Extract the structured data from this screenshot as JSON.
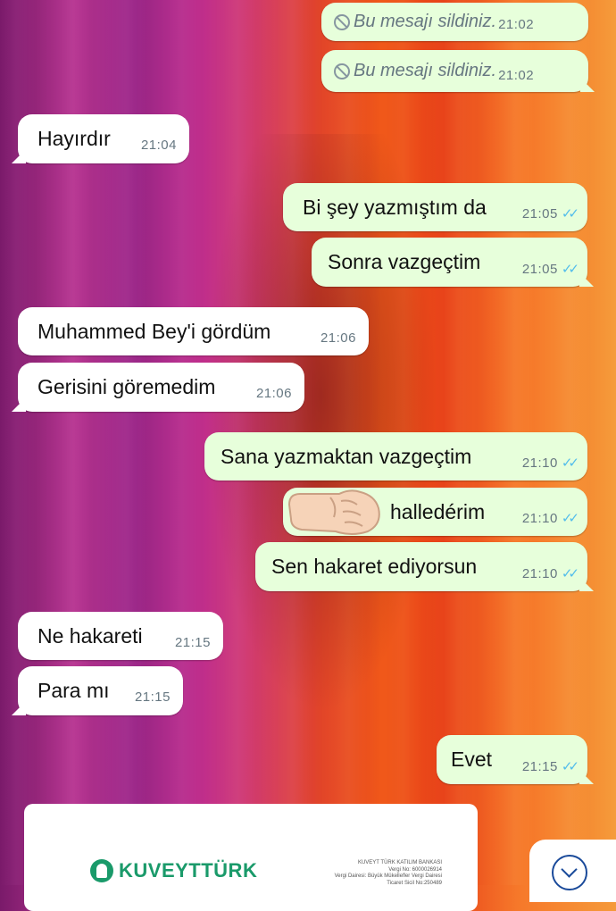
{
  "chat": {
    "messages": [
      {
        "dir": "out",
        "deleted": true,
        "text": "Bu mesajı sildiniz.",
        "time": "21:02"
      },
      {
        "dir": "out",
        "deleted": true,
        "text": "Bu mesajı sildiniz.",
        "time": "21:02"
      },
      {
        "dir": "in",
        "text": "Hayırdır",
        "time": "21:04"
      },
      {
        "dir": "out",
        "text": "Bi şey yazmıştım da",
        "time": "21:05",
        "status": "read"
      },
      {
        "dir": "out",
        "text": "Sonra vazgeçtim",
        "time": "21:05",
        "status": "read"
      },
      {
        "dir": "in",
        "text": "Muhammed Bey'i gördüm",
        "time": "21:06"
      },
      {
        "dir": "in",
        "text": "Gerisini göremedim",
        "time": "21:06"
      },
      {
        "dir": "out",
        "text": "Sana yazmaktan vazgeçtim",
        "time": "21:10",
        "status": "read"
      },
      {
        "dir": "out",
        "text": "halledérim",
        "time": "21:10",
        "status": "read"
      },
      {
        "dir": "out",
        "text": "Sen hakaret ediyorsun",
        "time": "21:10",
        "status": "read"
      },
      {
        "dir": "in",
        "text": "Ne hakareti",
        "time": "21:15"
      },
      {
        "dir": "in",
        "text": "Para mı",
        "time": "21:15"
      },
      {
        "dir": "out",
        "text": "Evet",
        "time": "21:15",
        "status": "read"
      }
    ],
    "read_ticks": "✓✓"
  },
  "card": {
    "brand": "KUVEYTTÜRK",
    "smallprint": [
      "KUVEYT TÜRK KATILIM BANKASI",
      "Vergi No: 6000026914",
      "Vergi Dairesi: Büyük Mükellefler Vergi Dairesi",
      "Ticaret Sicil No:250489"
    ]
  },
  "colors": {
    "incoming": "#ffffff",
    "outgoing": "#e7ffdb",
    "tick": "#53bdeb",
    "brand": "#1a9a6a"
  },
  "icons": {
    "deleted": "ban-icon",
    "scroll": "chevron-down-icon",
    "emoji": "fist-emoji-icon"
  }
}
